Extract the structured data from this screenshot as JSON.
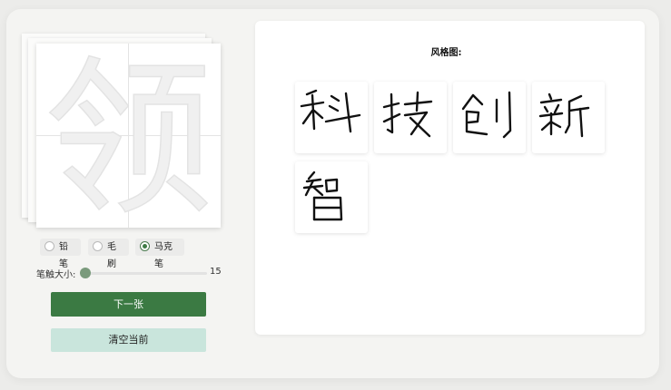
{
  "practice": {
    "character": "领"
  },
  "brush": {
    "options": [
      {
        "label": "铅笔",
        "selected": false
      },
      {
        "label": "毛刷",
        "selected": false
      },
      {
        "label": "马克笔",
        "selected": true
      }
    ]
  },
  "stroke_size": {
    "label": "笔触大小:",
    "value": "15"
  },
  "buttons": {
    "next": "下一张",
    "clear": "清空当前"
  },
  "style_panel": {
    "title": "风格图:",
    "samples": [
      "科",
      "技",
      "创",
      "新",
      "智"
    ]
  },
  "colors": {
    "primary": "#3b7a43",
    "secondary": "#c9e5dc",
    "slider_thumb": "#7a9a7c"
  }
}
